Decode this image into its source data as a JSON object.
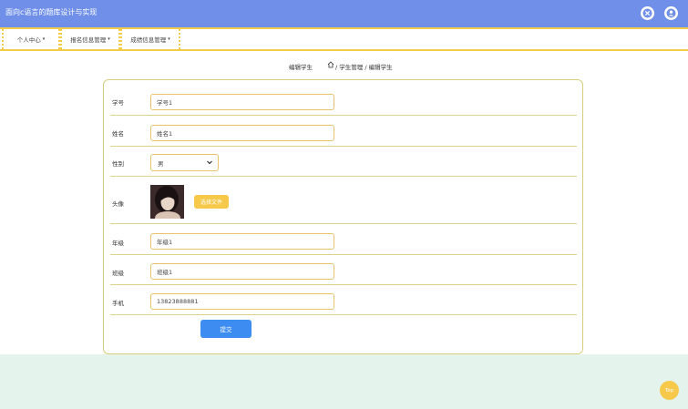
{
  "header": {
    "title": "面向c语言的题库设计与实现",
    "icons": [
      "close-icon",
      "user-icon"
    ]
  },
  "nav": {
    "items": [
      {
        "label": "个人中心"
      },
      {
        "label": "报名信息管理"
      },
      {
        "label": "成绩信息管理"
      }
    ]
  },
  "breadcrumb": {
    "title": "编辑学生",
    "path": "/ 学生管理 / 编辑学生"
  },
  "form": {
    "student_no": {
      "label": "学号",
      "value": "学号1"
    },
    "name": {
      "label": "姓名",
      "value": "姓名1"
    },
    "gender": {
      "label": "性别",
      "value": "男"
    },
    "avatar": {
      "label": "头像",
      "button": "选择文件"
    },
    "grade": {
      "label": "年级",
      "value": "年级1"
    },
    "class": {
      "label": "班级",
      "value": "班级1"
    },
    "phone": {
      "label": "手机",
      "value": "13823888881"
    },
    "submit": "提交"
  },
  "top_button": "Top",
  "colors": {
    "header": "#6f8fe8",
    "accent_yellow": "#f2cd4c",
    "submit_blue": "#3d8cf2",
    "footer": "#e4f3eb"
  }
}
